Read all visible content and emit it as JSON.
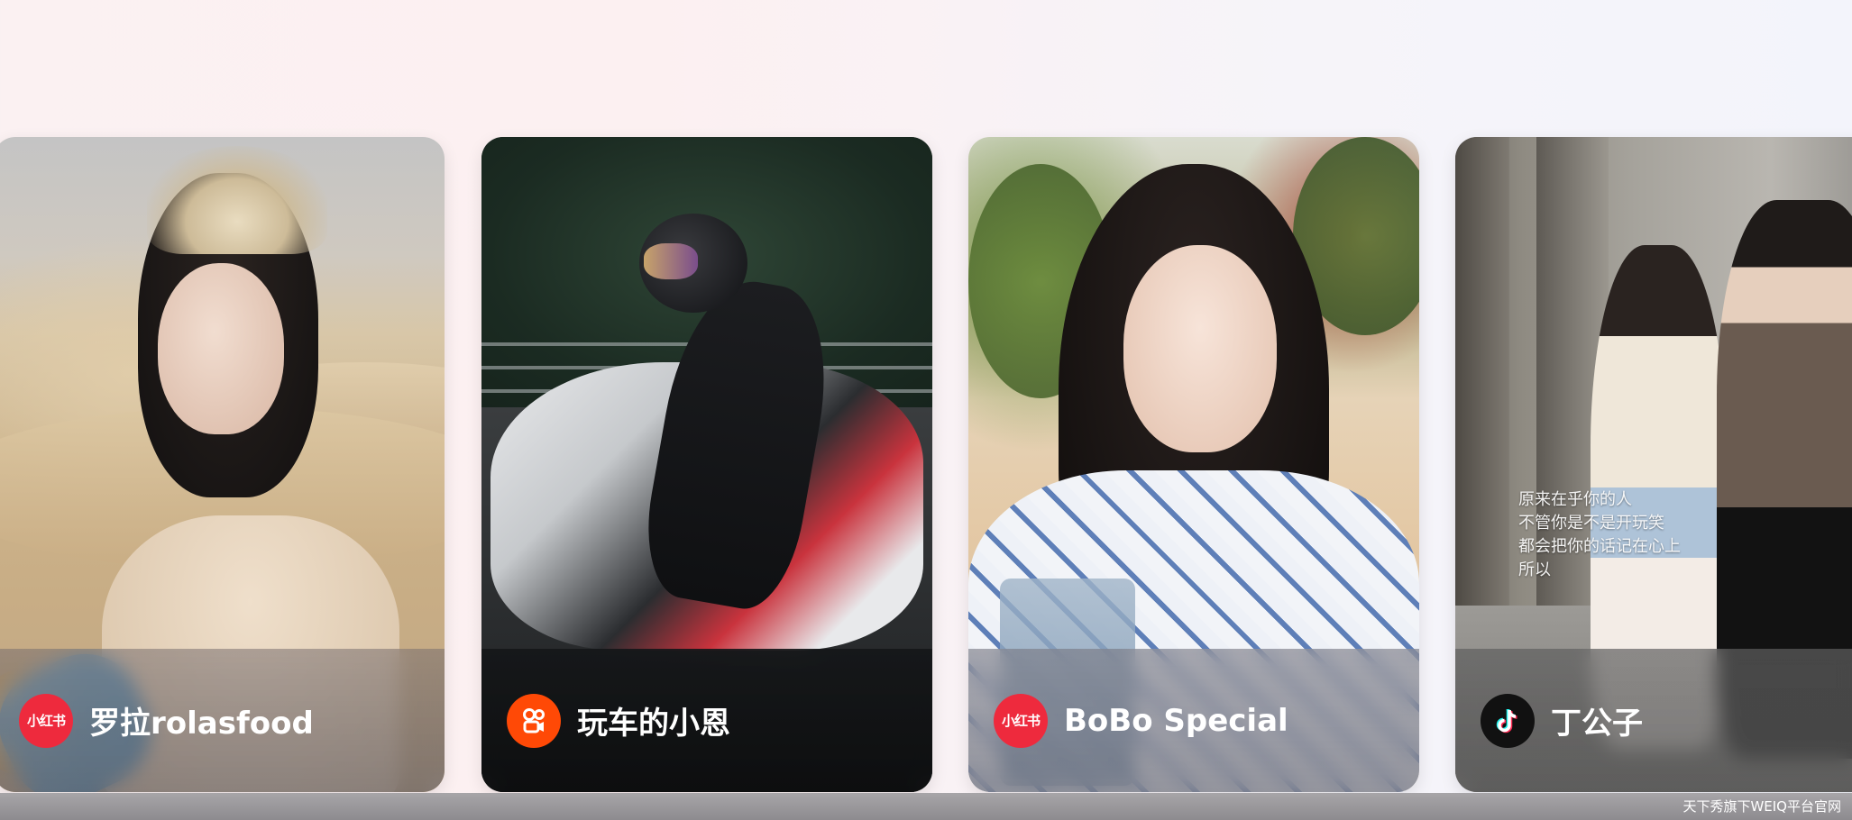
{
  "creators": [
    {
      "name": "罗拉rolasfood",
      "platform": {
        "name": "xiaohongshu",
        "icon": "xiaohongshu-icon",
        "label": "小红书",
        "color": "#ee2a3d"
      }
    },
    {
      "name": "玩车的小恩",
      "platform": {
        "name": "kuaishou",
        "icon": "kuaishou-icon",
        "color": "#ff4906"
      }
    },
    {
      "name": "BoBo Special",
      "platform": {
        "name": "xiaohongshu",
        "icon": "xiaohongshu-icon",
        "label": "小红书",
        "color": "#ee2a3d"
      }
    },
    {
      "name": "丁公子",
      "platform": {
        "name": "douyin",
        "icon": "douyin-icon",
        "color": "#111111"
      }
    }
  ],
  "card4_caption": [
    "原来在乎你的人",
    "不管你是不是开玩笑",
    "都会把你的话记在心上",
    "所以"
  ],
  "footer": {
    "watermark": "天下秀旗下WEIQ平台官网"
  }
}
